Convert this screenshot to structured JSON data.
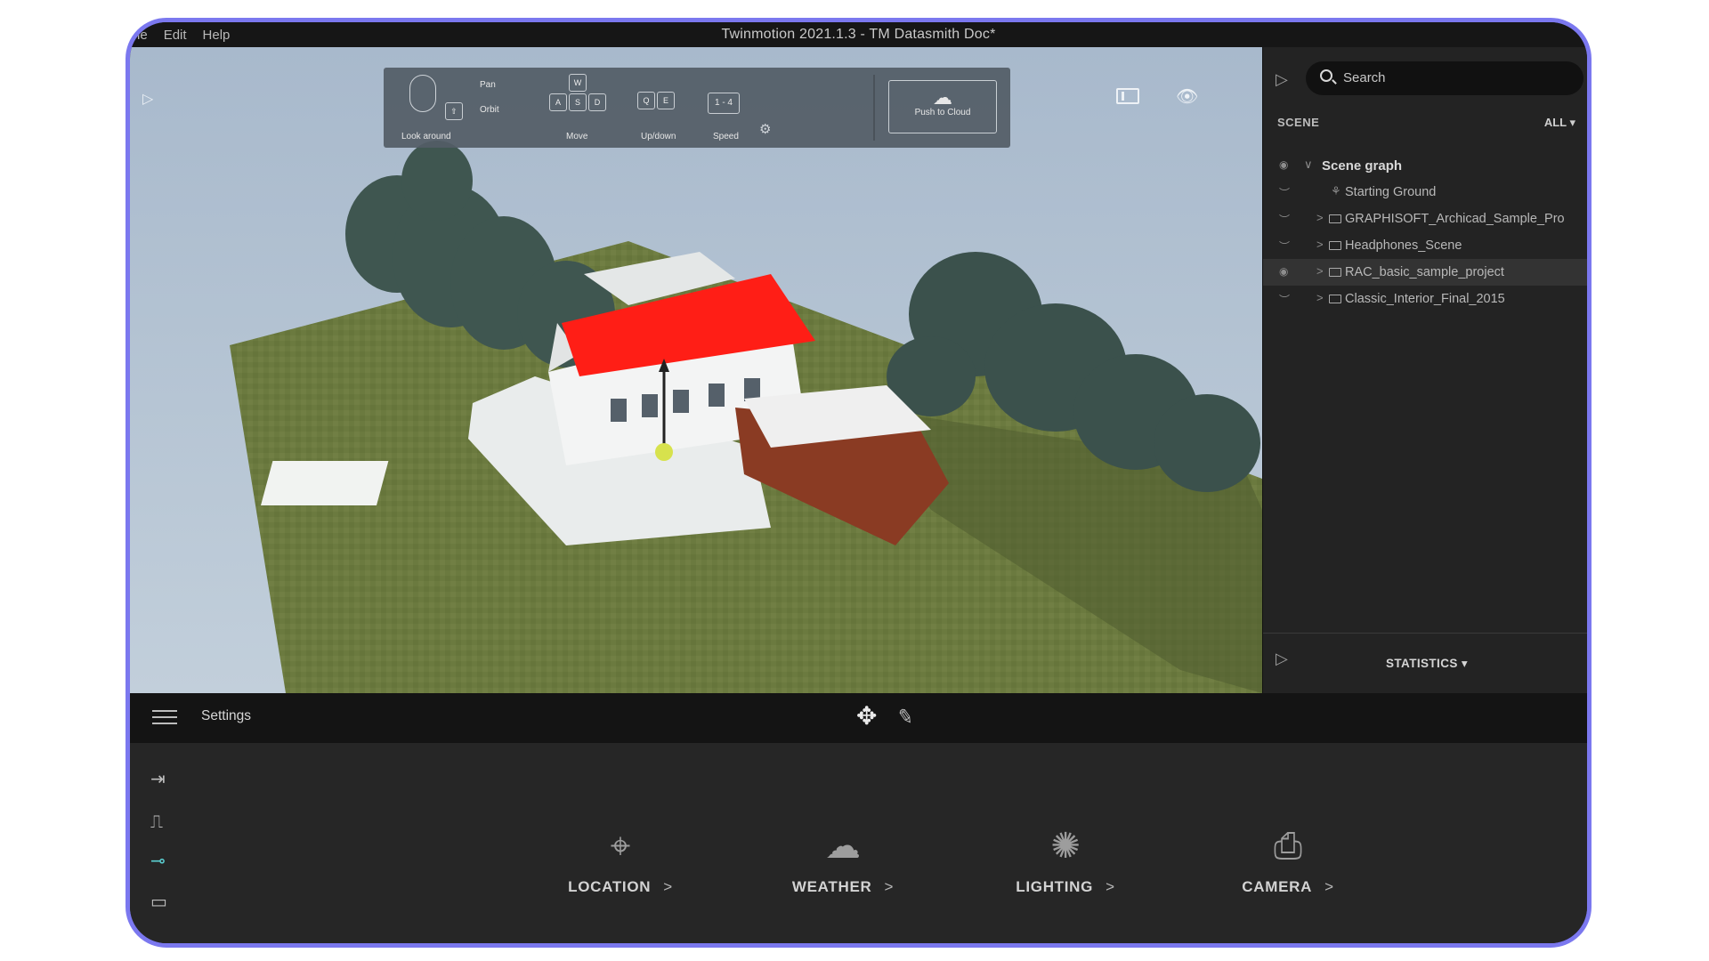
{
  "window": {
    "menu": [
      "le",
      "Edit",
      "Help"
    ],
    "title": "Twinmotion 2021.1.3 - TM Datasmith Doc*"
  },
  "viewport": {
    "nav_help": {
      "look_around": "Look around",
      "pan": "Pan",
      "orbit": "Orbit",
      "move": "Move",
      "updown": "Up/down",
      "speed": "Speed",
      "speed_keys": "1 - 4",
      "push_to_cloud": "Push to Cloud",
      "keys_move": [
        "W",
        "A",
        "S",
        "D"
      ],
      "keys_updown": [
        "Q",
        "E"
      ]
    },
    "icons": [
      "expand-icon",
      "panel-toggle-icon",
      "eye-icon",
      "gear-icon",
      "cloud-upload-icon"
    ]
  },
  "scene_panel": {
    "search_placeholder": "Search",
    "section": "SCENE",
    "filter": "ALL",
    "tree": [
      {
        "label": "Scene graph",
        "root": true
      },
      {
        "label": "Starting Ground"
      },
      {
        "label": "GRAPHISOFT_Archicad_Sample_Pro"
      },
      {
        "label": "Headphones_Scene"
      },
      {
        "label": "RAC_basic_sample_project",
        "selected": true
      },
      {
        "label": "Classic_Interior_Final_2015"
      }
    ],
    "statistics": "STATISTICS"
  },
  "toolbar": {
    "settings_label": "Settings"
  },
  "categories": [
    {
      "label": "LOCATION",
      "icon": "location-pin-icon"
    },
    {
      "label": "WEATHER",
      "icon": "weather-icon"
    },
    {
      "label": "LIGHTING",
      "icon": "lighting-icon"
    },
    {
      "label": "CAMERA",
      "icon": "camera-icon"
    }
  ],
  "colors": {
    "frame_border": "#7b78ef",
    "roof": "#ff1e16",
    "ground": "#6b7a3f",
    "accent": "#5bd0d3"
  }
}
